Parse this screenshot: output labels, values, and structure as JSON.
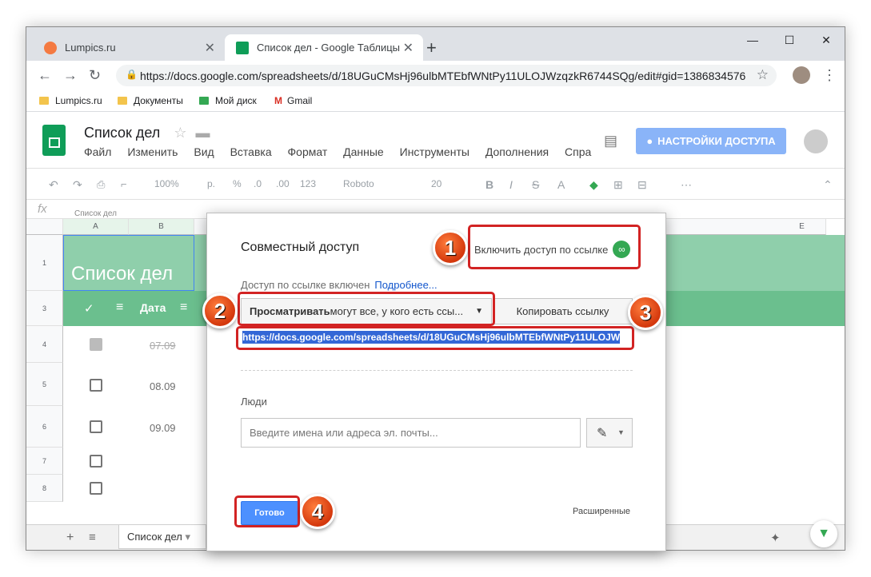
{
  "browser": {
    "tabs": [
      {
        "title": "Lumpics.ru",
        "active": false
      },
      {
        "title": "Список дел - Google Таблицы",
        "active": true
      }
    ],
    "new_tab": "+",
    "window_controls": [
      "—",
      "☐",
      "✕"
    ],
    "url": "https://docs.google.com/spreadsheets/d/18UGuCMsHj96ulbMTEbfWNtPy11ULOJWzqzkR6744SQg/edit#gid=1386834576",
    "bookmarks": [
      "Lumpics.ru",
      "Документы",
      "Мой диск",
      "Gmail"
    ]
  },
  "docs": {
    "title": "Список дел",
    "menu": [
      "Файл",
      "Изменить",
      "Вид",
      "Вставка",
      "Формат",
      "Данные",
      "Инструменты",
      "Дополнения",
      "Спра"
    ],
    "share_button": "НАСТРОЙКИ ДОСТУПА",
    "toolbar": {
      "zoom": "100%",
      "currency": "р.",
      "percent": "%",
      "dec_less": ".0",
      "dec_more": ".00",
      "format": "123",
      "font": "Roboto",
      "size": "20"
    },
    "fx": "fx",
    "formula_text": "Список дел",
    "columns": [
      "A",
      "B",
      "E"
    ],
    "rows": [
      "1",
      "3",
      "4",
      "5",
      "6",
      "7",
      "8"
    ],
    "sheet_title": "Список дел",
    "header_check": "✓",
    "header_date": "Дата",
    "dates": [
      "07.09",
      "08.09",
      "09.09"
    ],
    "sheet_tab": "Список дел"
  },
  "dialog": {
    "title": "Совместный доступ",
    "enable_link": "Включить доступ по ссылке",
    "link_state": "Доступ по ссылке включен",
    "more": "Подробнее...",
    "permission_bold": "Просматривать",
    "permission_rest": " могут все, у кого есть ссы...",
    "copy_link": "Копировать ссылку",
    "share_url": "https://docs.google.com/spreadsheets/d/18UGuCMsHj96ulbMTEbfWNtPy11ULOJW",
    "people_label": "Люди",
    "people_placeholder": "Введите имена или адреса эл. почты...",
    "done": "Готово",
    "advanced": "Расширенные"
  },
  "steps": [
    "1",
    "2",
    "3",
    "4"
  ],
  "colors": {
    "highlight": "#d22323",
    "badge": "#e4531d",
    "primary": "#4d90fe",
    "sheets_green": "#0f9d58"
  }
}
